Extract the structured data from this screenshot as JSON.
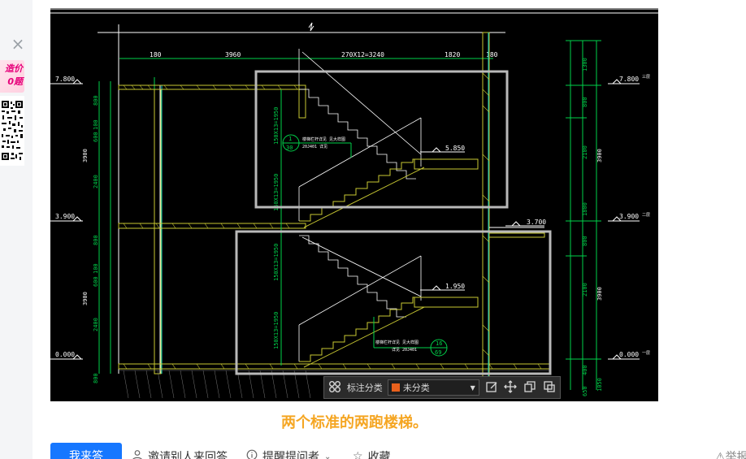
{
  "sidebar": {
    "close_glyph": "×",
    "ad_line1": "造价",
    "ad_line2": "0题"
  },
  "cad": {
    "top_dims": [
      "180",
      "3960",
      "270X12=3240",
      "1820",
      "180"
    ],
    "levels_left": [
      "7.800",
      "3.900",
      "0.000"
    ],
    "levels_right": [
      "7.800",
      "3.900",
      "0.000"
    ],
    "left_dims": [
      "800",
      "100",
      "600",
      "2400",
      "3900",
      "800",
      "100",
      "600",
      "2400",
      "3900",
      "800"
    ],
    "right_dims": [
      "1300",
      "800",
      "2100",
      "3900",
      "1800",
      "800",
      "2100",
      "3900",
      "400",
      "650",
      "1050"
    ],
    "stair_dims_upper": [
      "150X13=1950",
      "150X13=1950"
    ],
    "stair_dims_lower": [
      "150X13=1950",
      "150X13=1950"
    ],
    "landing_levels": [
      "5.850",
      "3.700",
      "1.950"
    ],
    "callout_upper": {
      "top": "1",
      "bottom": "30",
      "note1": "楼梯栏杆详见 见大样图",
      "note2": "20J401 详见"
    },
    "callout_lower": {
      "top": "16",
      "bottom": "69",
      "note1": "楼梯栏杆详见 见大样图",
      "note2": "详见 20J401"
    },
    "floor_tags": [
      "三层",
      "二层",
      "一层"
    ]
  },
  "anno_toolbar": {
    "grid_icon": "grid-icon",
    "label": "标注分类",
    "select_value": "未分类",
    "swatch_color": "#e8601c",
    "tools": [
      "edit-icon",
      "move-icon",
      "copy-icon",
      "paste-icon"
    ]
  },
  "caption": "两个标准的两跑楼梯。",
  "actions": {
    "answer": "我来答",
    "invite": "邀请别人来回答",
    "remind": "提醒提问者",
    "favorite": "收藏",
    "report": "举报"
  },
  "colors": {
    "accent": "#1677ff",
    "caption": "#f5a623",
    "cad_bg": "#000000",
    "cad_green": "#00d24a",
    "cad_yellow": "#c8c832",
    "highlight_box": "#b9b9b9"
  }
}
